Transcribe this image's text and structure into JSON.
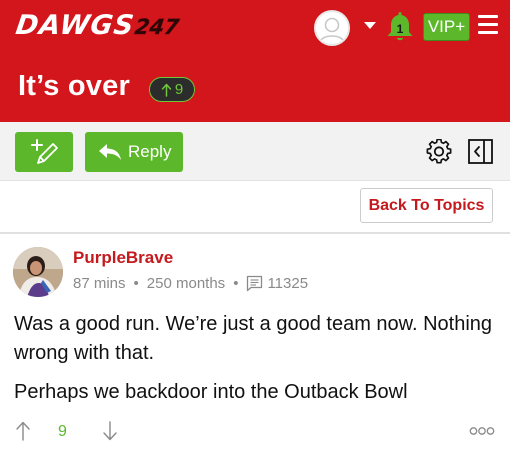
{
  "header": {
    "logo_text": "DAWGS",
    "logo_number": "247",
    "notification_count": "1",
    "vip_label": "VIP+",
    "accent_color": "#d3151c"
  },
  "thread": {
    "title": "It’s over",
    "upvotes": "9"
  },
  "toolbar": {
    "new_post_icon": "pencil-plus-icon",
    "reply_label": "Reply",
    "settings_icon": "gear-icon",
    "panel_icon": "collapse-panel-icon",
    "button_color": "#5cb82a"
  },
  "back_to_topics_label": "Back To Topics",
  "post": {
    "author": "PurpleBrave",
    "posted_ago": "87 mins",
    "member_tenure": "250 months",
    "message_count": "11325",
    "paragraphs": [
      "Was a good run. We’re just a good team now. Nothing wrong with that.",
      "Perhaps we backdoor into the Outback Bowl"
    ],
    "score": "9"
  }
}
